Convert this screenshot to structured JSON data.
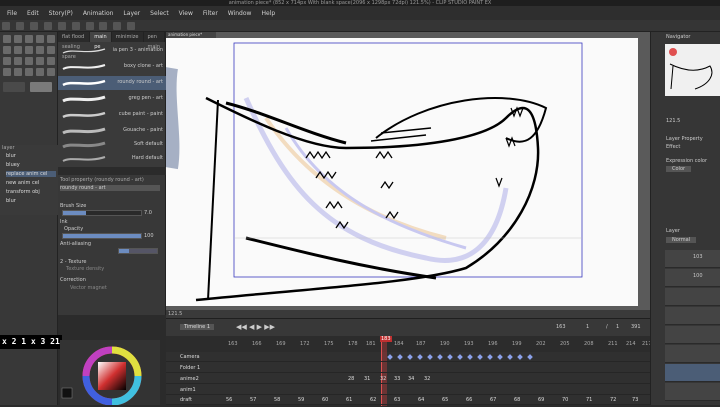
{
  "window": {
    "title": "animation piece* (852 x 714px With blank space(2096 x 1298px 72dpi) 121.5%) - CLIP STUDIO PAINT EX"
  },
  "menu": {
    "items": [
      "File",
      "Edit",
      "Story(P)",
      "Animation",
      "Layer",
      "Select",
      "View",
      "Filter",
      "Window",
      "Help"
    ]
  },
  "brush_panel": {
    "tabs": [
      "flat flood sealing spare",
      "main pe",
      "minimize",
      "pen main"
    ],
    "brushes": [
      {
        "name": "ia pen 3 - animation",
        "selected": false
      },
      {
        "name": "boxy clone - art",
        "selected": false
      },
      {
        "name": "roundy round - art",
        "selected": true
      },
      {
        "name": "greg pen - art",
        "selected": false
      },
      {
        "name": "cube paint - paint",
        "selected": false
      },
      {
        "name": "Gouache - paint",
        "selected": false
      },
      {
        "name": "Soft default",
        "selected": false
      },
      {
        "name": "Hard default",
        "selected": false
      }
    ]
  },
  "tool_property": {
    "header": "Tool property (roundy round - art)",
    "subheader": "roundy round - art",
    "brush_size_label": "Brush Size",
    "brush_size_value": "7.0",
    "ink_label": "Ink",
    "opacity_label": "Opacity",
    "opacity_value": "100",
    "antialias_label": "Anti-aliasing",
    "texture_label": "2 - Texture",
    "texture_density_label": "Texture density",
    "correction_label": "Correction",
    "vector_magnet_label": "Vector magnet"
  },
  "left_layers": {
    "header": "layer",
    "items": [
      "blur",
      "bluey",
      "replace anim cel",
      "new anim cel",
      "transform obj",
      "blur"
    ]
  },
  "big_overlay_text": "x 2 1 x 3 21",
  "canvas": {
    "zoom": "121.5"
  },
  "timeline": {
    "name": "Timeline 1",
    "current_frame": "183",
    "frame_controls": [
      "163",
      "1",
      "/",
      "1",
      "391"
    ],
    "ruler": [
      "163",
      "166",
      "169",
      "172",
      "175",
      "178",
      "181",
      "184",
      "187",
      "190",
      "193",
      "196",
      "199",
      "202",
      "205",
      "208",
      "211",
      "214",
      "217"
    ],
    "tracks": [
      {
        "name": "Camera"
      },
      {
        "name": "Folder 1"
      },
      {
        "name": "anime2"
      },
      {
        "name": "anim1"
      },
      {
        "name": "draft"
      }
    ],
    "anime2_cells": [
      "28",
      "31",
      "32",
      "33",
      "34",
      "32"
    ],
    "draft_cells": [
      "65",
      "66",
      "56",
      "57",
      "58",
      "59",
      "60",
      "61",
      "62",
      "63",
      "64",
      "65",
      "66",
      "67",
      "68",
      "69",
      "70",
      "71",
      "72",
      "73"
    ]
  },
  "right_panel": {
    "navigator_label": "Navigator",
    "zoom_value": "121.5",
    "layer_property_label": "Layer Property",
    "effect_label": "Effect",
    "expression_color_label": "Expression color",
    "expression_color_value": "Color",
    "layer_label": "Layer",
    "blend_mode": "Normal",
    "layers": [
      "103",
      "100",
      "",
      "",
      ""
    ]
  },
  "colors": {
    "accent": "#6c8cc0",
    "selection": "#4b5d76",
    "playhead": "#e05050"
  }
}
